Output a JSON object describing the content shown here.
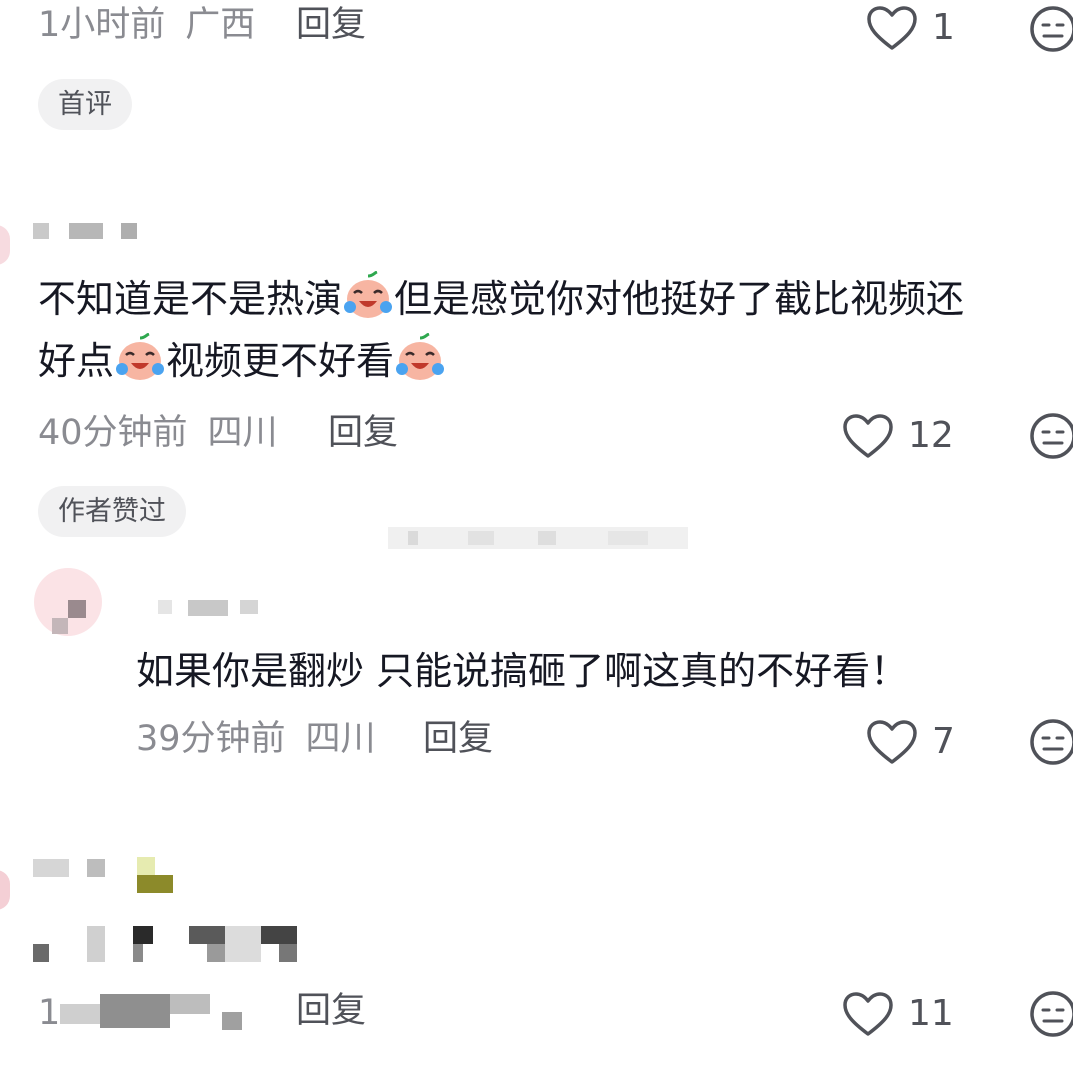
{
  "comments": [
    {
      "time": "1小时前",
      "location": "广西",
      "reply_label": "回复",
      "likes": "1",
      "tag": "首评"
    },
    {
      "text_part1": "不知道是不是热演",
      "text_part2": "但是感觉你对他挺好了截比视频还",
      "text_part3": "好点",
      "text_part4": "视频更不好看",
      "time": "40分钟前",
      "location": "四川",
      "reply_label": "回复",
      "likes": "12",
      "tag": "作者赞过",
      "emoji": "crying-laughing-peach"
    },
    {
      "text": "如果你是翻炒 只能说搞砸了啊这真的不好看！",
      "time": "39分钟前",
      "location": "四川",
      "reply_label": "回复",
      "likes": "7"
    },
    {
      "time_partial": "1",
      "reply_label": "回复",
      "likes": "11"
    }
  ],
  "icons": {
    "like": "heart-outline-icon",
    "dislike": "meh-face-icon"
  },
  "colors": {
    "text": "#161823",
    "meta": "#8a8b91",
    "tag_bg": "#f1f1f2",
    "avatar_accent": "#c8102e"
  }
}
